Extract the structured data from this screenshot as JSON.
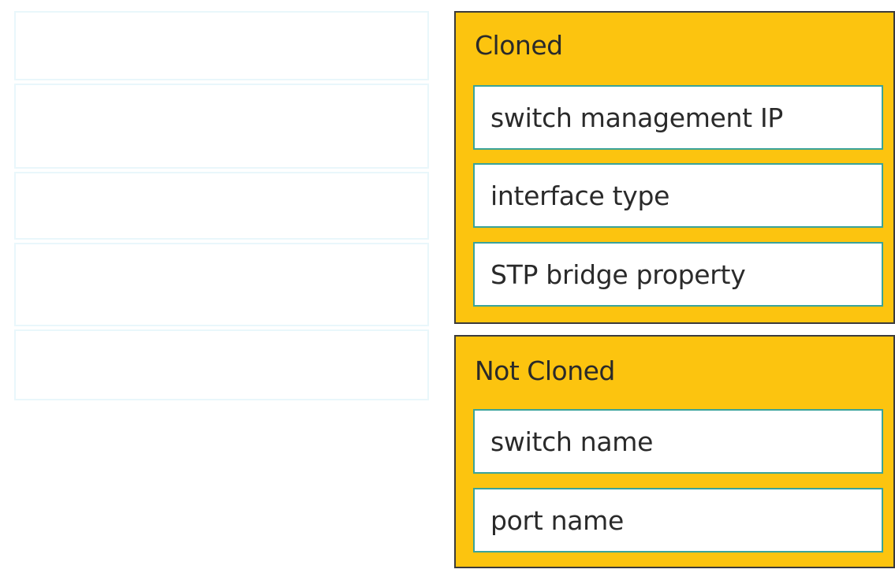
{
  "source_slots": 5,
  "groups": {
    "cloned": {
      "title": "Cloned",
      "items": [
        "switch management IP",
        "interface type",
        "STP bridge property"
      ]
    },
    "not_cloned": {
      "title": "Not Cloned",
      "items": [
        "switch name",
        "port name"
      ]
    }
  },
  "colors": {
    "group_fill": "#fcc40f",
    "group_border": "#3b3b3b",
    "item_border": "#3aa39a",
    "slot_border": "#e9f7fb"
  }
}
